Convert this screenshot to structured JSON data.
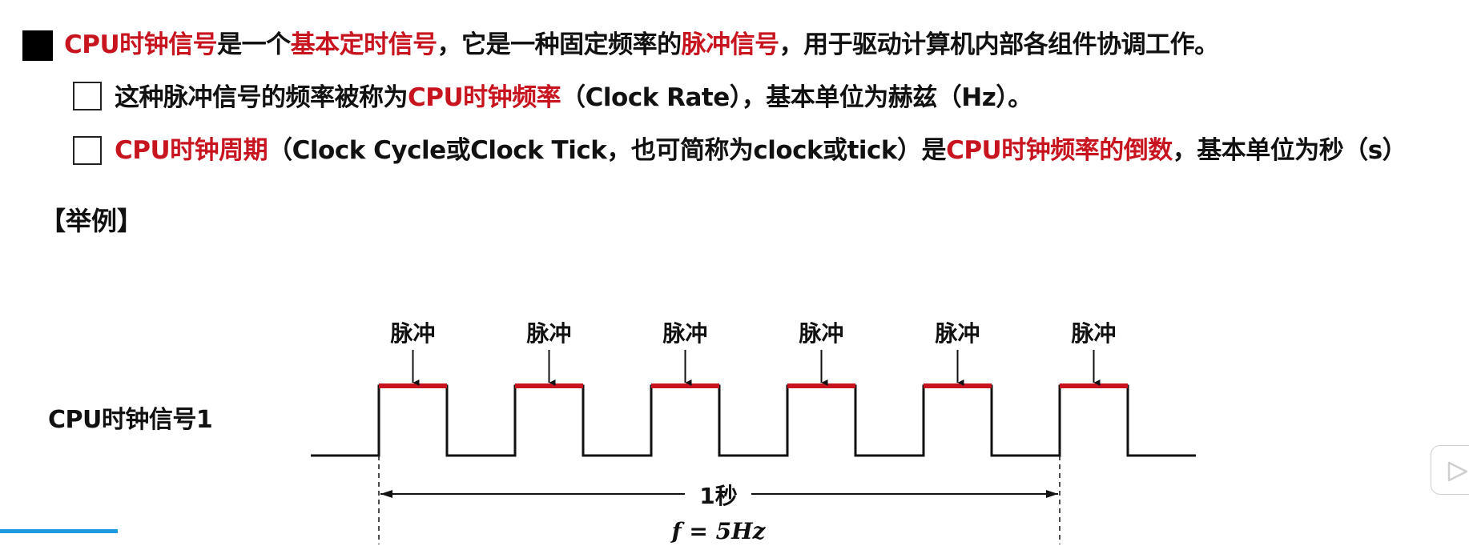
{
  "main_statement": {
    "segments": [
      {
        "text": "CPU时钟信号",
        "red": true
      },
      {
        "text": "是一个",
        "red": false
      },
      {
        "text": "基本定时信号",
        "red": true
      },
      {
        "text": "，它是一种固定频率的",
        "red": false
      },
      {
        "text": "脉冲信号",
        "red": true
      },
      {
        "text": "，用于驱动计算机内部各组件协调工作。",
        "red": false
      }
    ]
  },
  "bullets": [
    {
      "segments": [
        {
          "text": "这种脉冲信号的频率被称为",
          "red": false
        },
        {
          "text": "CPU时钟频率",
          "red": true
        },
        {
          "text": "（Clock Rate），基本单位为赫兹（Hz）。",
          "red": false
        }
      ]
    },
    {
      "segments": [
        {
          "text": "CPU时钟周期",
          "red": true
        },
        {
          "text": "（Clock Cycle或Clock Tick，也可简称为clock或tick）是",
          "red": false
        },
        {
          "text": "CPU时钟频率的倒数",
          "red": true
        },
        {
          "text": "，基本单位为秒（s）",
          "red": false
        }
      ]
    }
  ],
  "example_heading": "【举例】",
  "diagram": {
    "signal_label": "CPU时钟信号1",
    "pulse_label": "脉冲",
    "pulse_count": 5,
    "pulses_per_second": 5,
    "span_label": "1秒",
    "frequency_label": "f = 5Hz",
    "colors": {
      "signal": "#111111",
      "pulse_highlight": "#c8141e",
      "text_red": "#c8141e"
    }
  },
  "video_progress": 0.08,
  "icons": [
    "play-icon"
  ]
}
